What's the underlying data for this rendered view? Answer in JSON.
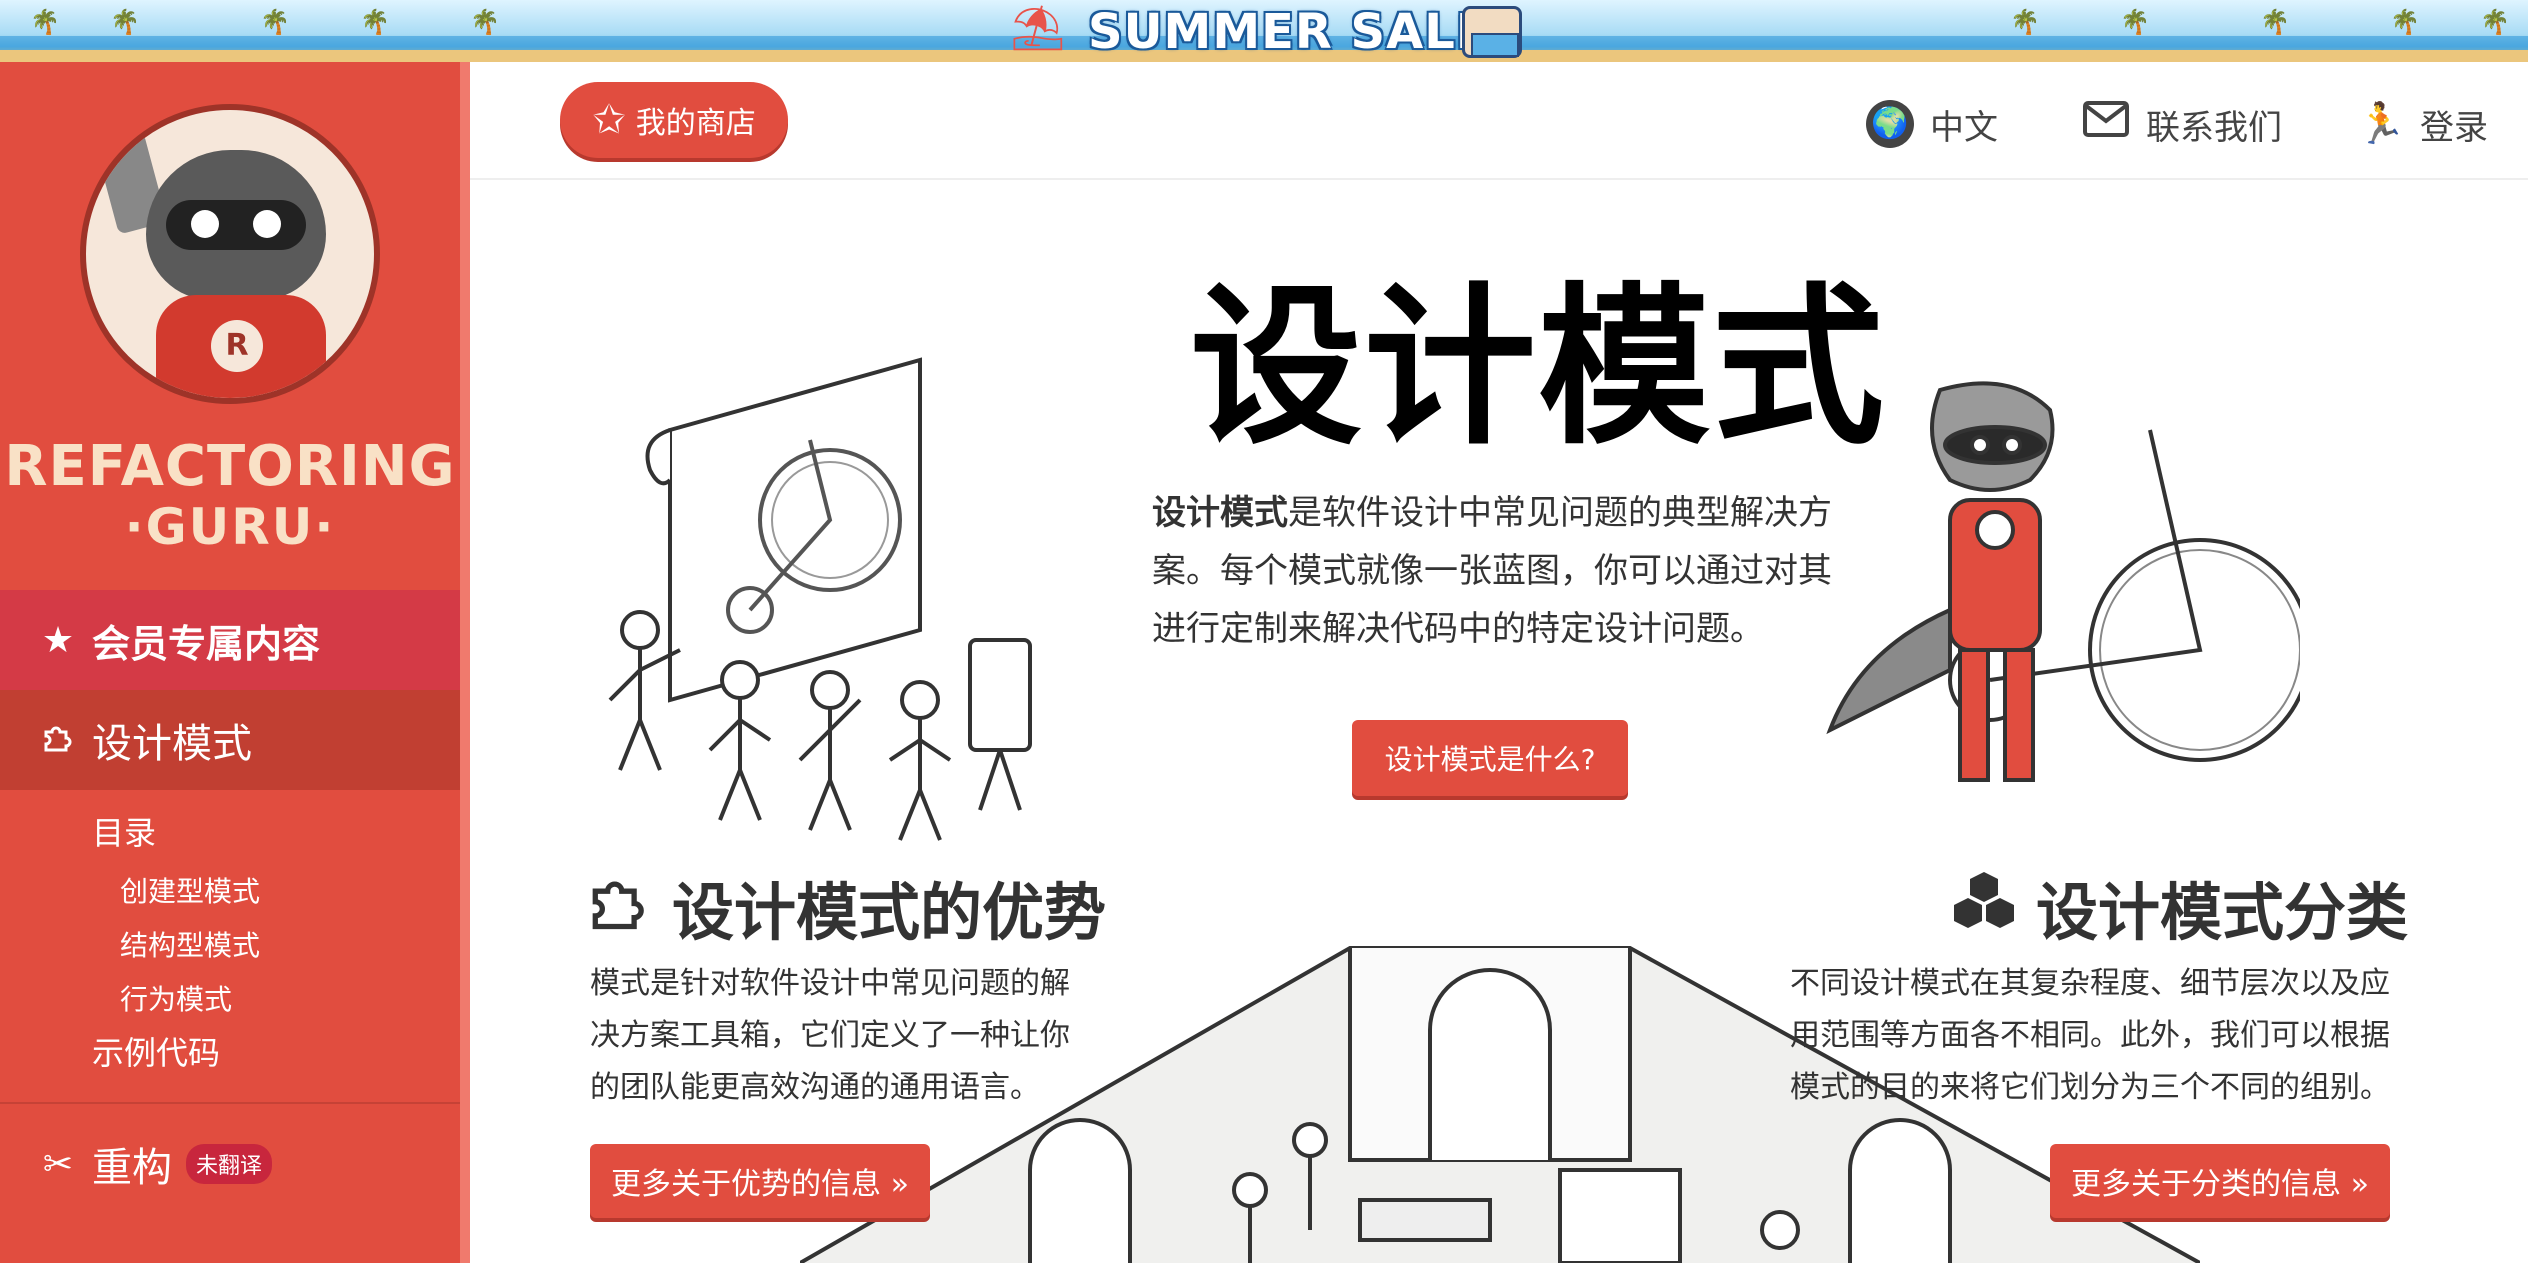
{
  "banner": {
    "title": "SUMMER SALE"
  },
  "sidebar": {
    "brand_line1": "REFACTORING",
    "brand_line2": "·GURU·",
    "premium_label": "会员专属内容",
    "patterns_label": "设计模式",
    "toc_label": "目录",
    "creational_label": "创建型模式",
    "structural_label": "结构型模式",
    "behavioral_label": "行为模式",
    "examples_label": "示例代码",
    "refactoring_label": "重构",
    "untranslated_badge": "未翻译"
  },
  "header": {
    "shop_label": "我的商店",
    "lang_label": "中文",
    "contact_label": "联系我们",
    "login_label": "登录"
  },
  "hero": {
    "title": "设计模式",
    "text_bold": "设计模式",
    "text_rest": "是软件设计中常见问题的典型解决方案。每个模式就像一张蓝图，你可以通过对其进行定制来解决代码中的特定设计问题。",
    "button_label": "设计模式是什么?"
  },
  "benefits": {
    "title": "设计模式的优势",
    "text": "模式是针对软件设计中常见问题的解决方案工具箱，它们定义了一种让你的团队能更高效沟通的通用语言。",
    "button_label": "更多关于优势的信息 »"
  },
  "classification": {
    "title": "设计模式分类",
    "text": "不同设计模式在其复杂程度、细节层次以及应用范围等方面各不相同。此外，我们可以根据模式的目的来将它们划分为三个不同的组别。",
    "button_label": "更多关于分类的信息 »"
  },
  "colors": {
    "sidebar": "#e14d3f",
    "premium": "#d43a46",
    "active": "#c13f32",
    "button": "#e14d3f"
  },
  "icons": {
    "shop": "star-icon",
    "lang": "globe-icon",
    "contact": "envelope-icon",
    "login": "runner-icon",
    "premium": "star-icon",
    "patterns": "puzzle-icon",
    "refactoring": "scissors-icon",
    "benefits": "puzzle-icon",
    "classification": "cubes-icon"
  }
}
